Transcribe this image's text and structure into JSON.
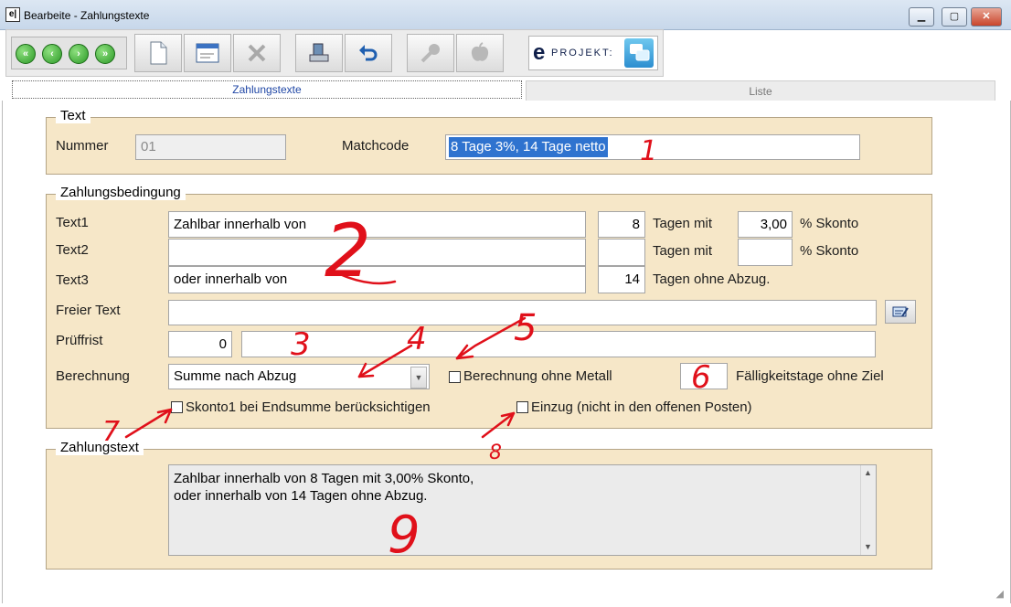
{
  "window": {
    "title": "Bearbeite - Zahlungstexte",
    "app_icon": "e|",
    "minimize": "▁",
    "maximize": "▢",
    "close": "✕"
  },
  "toolbar": {
    "nav_first": "«",
    "nav_prev": "‹",
    "nav_next": "›",
    "nav_last": "»",
    "btn_new_icon": "new-document-icon",
    "btn_edit_icon": "edit-form-icon",
    "btn_delete_icon": "delete-icon",
    "btn_save_icon": "save-icon",
    "btn_undo_icon": "undo-icon",
    "btn_search_icon": "key-icon",
    "btn_disabled_icon": "apple-icon",
    "brand_e": "e",
    "brand_text": "PROJEKT:"
  },
  "tabs": [
    {
      "label": "Zahlungstexte",
      "active": true
    },
    {
      "label": "Liste",
      "active": false
    }
  ],
  "text_group": {
    "legend": "Text",
    "nummer_label": "Nummer",
    "nummer_value": "01",
    "matchcode_label": "Matchcode",
    "matchcode_value": "8 Tage 3%, 14 Tage netto"
  },
  "zahlungsbedingung": {
    "legend": "Zahlungsbedingung",
    "text1_label": "Text1",
    "text1_value": "Zahlbar innerhalb von",
    "text1_days": "8",
    "text1_mid": "Tagen mit",
    "text1_percent": "3,00",
    "text1_suffix": "% Skonto",
    "text2_label": "Text2",
    "text2_value": "",
    "text2_days": "",
    "text2_mid": "Tagen mit",
    "text2_percent": "",
    "text2_suffix": "% Skonto",
    "text3_label": "Text3",
    "text3_value": "oder innerhalb von",
    "text3_days": "14",
    "text3_mid": "Tagen ohne Abzug.",
    "freier_text_label": "Freier Text",
    "freier_text_value": "",
    "prueffrist_label": "Prüffrist",
    "prueffrist_value": "0",
    "prueffrist_text": "",
    "berechnung_label": "Berechnung",
    "berechnung_value": "Summe nach Abzug",
    "ohne_metall_label": "Berechnung ohne Metall",
    "ohne_metall_checked": false,
    "faelligkeit_value": "",
    "faelligkeit_label": "Fälligkeitstage ohne Ziel",
    "skonto1_label": "Skonto1 bei Endsumme berücksichtigen",
    "skonto1_checked": false,
    "einzug_label": "Einzug (nicht in den offenen Posten)",
    "einzug_checked": false
  },
  "zahlungstext": {
    "legend": "Zahlungstext",
    "line1": "Zahlbar innerhalb von 8 Tagen mit 3,00% Skonto,",
    "line2": "oder innerhalb von 14 Tagen ohne Abzug."
  },
  "annotations": {
    "n1": "1",
    "n2": "2",
    "n3": "3",
    "n4": "4",
    "n5": "5",
    "n6": "6",
    "n7": "7",
    "n8": "8",
    "n9": "9",
    "color": "#e0101a"
  }
}
